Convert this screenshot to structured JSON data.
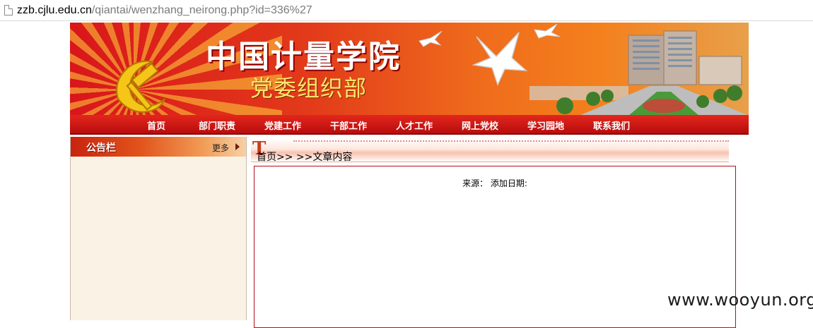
{
  "browser": {
    "url_host": "zzb.cjlu.edu.cn",
    "url_path": "/qiantai/wenzhang_neirong.php?id=336%27"
  },
  "banner": {
    "title": "中国计量学院",
    "subtitle": "党委组织部"
  },
  "nav": {
    "items": [
      "首页",
      "部门职责",
      "党建工作",
      "干部工作",
      "人才工作",
      "网上党校",
      "学习园地",
      "联系我们"
    ]
  },
  "sidebar": {
    "title": "公告栏",
    "more_label": "更多"
  },
  "content": {
    "breadcrumb": "首页>> >>文章内容",
    "meta": "来源：  添加日期:"
  },
  "watermark": "www.wooyun.org",
  "colors": {
    "nav_red": "#c8161a",
    "sidebar_bg": "#fbf2e6",
    "article_border": "#b01020"
  }
}
